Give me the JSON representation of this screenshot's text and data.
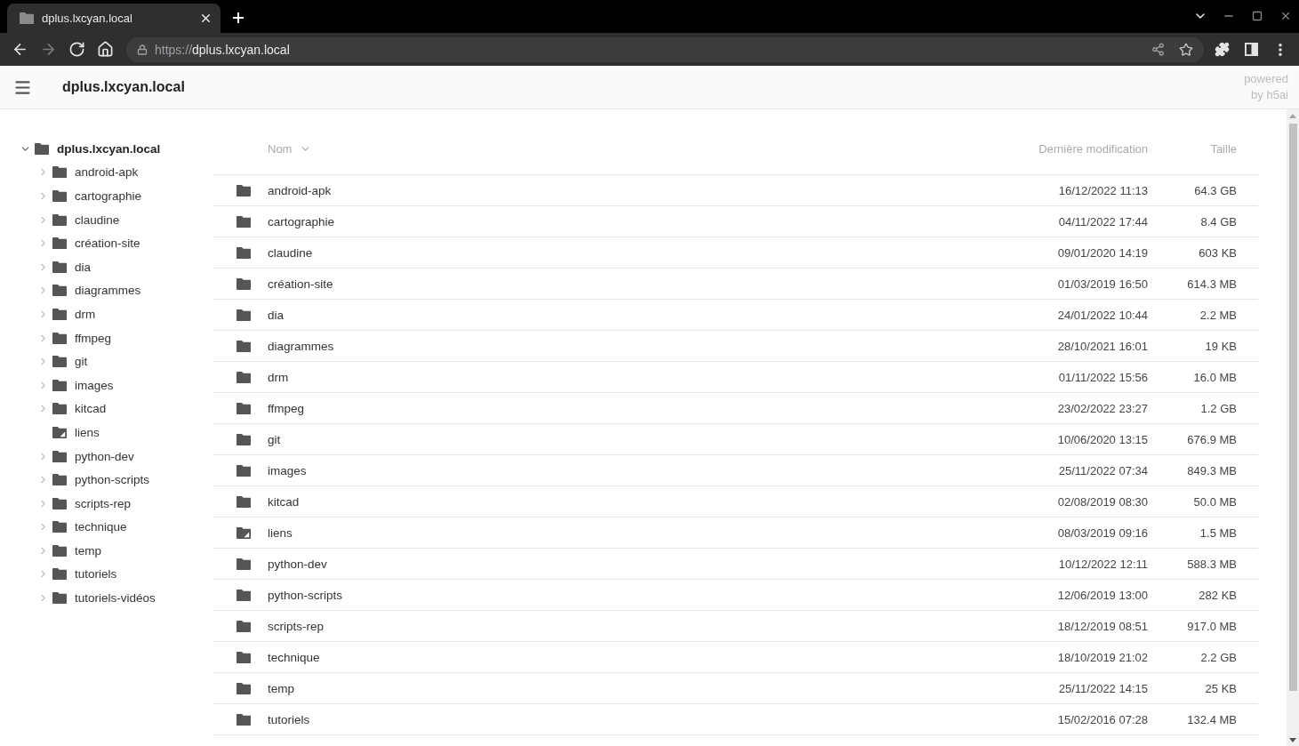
{
  "browser": {
    "tab": {
      "title": "dplus.lxcyan.local"
    },
    "nav_buttons": [
      {
        "kind": "back",
        "disabled": false
      },
      {
        "kind": "forward",
        "disabled": true
      },
      {
        "kind": "reload",
        "disabled": false
      },
      {
        "kind": "home",
        "disabled": false
      }
    ],
    "address": {
      "scheme": "https://",
      "host": "dplus.lxcyan.local"
    }
  },
  "header": {
    "title": "dplus.lxcyan.local",
    "credit": "powered by h5ai"
  },
  "tree": {
    "label": "dplus.lxcyan.local",
    "kind": "folder",
    "expanded": true,
    "children": [
      {
        "label": "android-apk",
        "kind": "folder",
        "expanded": false
      },
      {
        "label": "cartographie",
        "kind": "folder",
        "expanded": false
      },
      {
        "label": "claudine",
        "kind": "folder",
        "expanded": false
      },
      {
        "label": "création-site",
        "kind": "folder",
        "expanded": false
      },
      {
        "label": "dia",
        "kind": "folder",
        "expanded": false
      },
      {
        "label": "diagrammes",
        "kind": "folder",
        "expanded": false
      },
      {
        "label": "drm",
        "kind": "folder",
        "expanded": false
      },
      {
        "label": "ffmpeg",
        "kind": "folder",
        "expanded": false
      },
      {
        "label": "git",
        "kind": "folder",
        "expanded": false
      },
      {
        "label": "images",
        "kind": "folder",
        "expanded": false
      },
      {
        "label": "kitcad",
        "kind": "folder",
        "expanded": false
      },
      {
        "label": "liens",
        "kind": "link"
      },
      {
        "label": "python-dev",
        "kind": "folder",
        "expanded": false
      },
      {
        "label": "python-scripts",
        "kind": "folder",
        "expanded": false
      },
      {
        "label": "scripts-rep",
        "kind": "folder",
        "expanded": false
      },
      {
        "label": "technique",
        "kind": "folder",
        "expanded": false
      },
      {
        "label": "temp",
        "kind": "folder",
        "expanded": false
      },
      {
        "label": "tutoriels",
        "kind": "folder",
        "expanded": false
      },
      {
        "label": "tutoriels-vidéos",
        "kind": "folder",
        "expanded": false
      }
    ]
  },
  "table": {
    "columns": [
      {
        "label": "Nom",
        "sorted": true
      },
      {
        "label": "Dernière modification",
        "sorted": false
      },
      {
        "label": "Taille",
        "sorted": false
      }
    ],
    "rows": [
      {
        "kind": "folder",
        "name": "android-apk",
        "modified": "16/12/2022 11:13",
        "size": "64.3 GB"
      },
      {
        "kind": "folder",
        "name": "cartographie",
        "modified": "04/11/2022 17:44",
        "size": "8.4 GB"
      },
      {
        "kind": "folder",
        "name": "claudine",
        "modified": "09/01/2020 14:19",
        "size": "603 KB"
      },
      {
        "kind": "folder",
        "name": "création-site",
        "modified": "01/03/2019 16:50",
        "size": "614.3 MB"
      },
      {
        "kind": "folder",
        "name": "dia",
        "modified": "24/01/2022 10:44",
        "size": "2.2 MB"
      },
      {
        "kind": "folder",
        "name": "diagrammes",
        "modified": "28/10/2021 16:01",
        "size": "19 KB"
      },
      {
        "kind": "folder",
        "name": "drm",
        "modified": "01/11/2022 15:56",
        "size": "16.0 MB"
      },
      {
        "kind": "folder",
        "name": "ffmpeg",
        "modified": "23/02/2022 23:27",
        "size": "1.2 GB"
      },
      {
        "kind": "folder",
        "name": "git",
        "modified": "10/06/2020 13:15",
        "size": "676.9 MB"
      },
      {
        "kind": "folder",
        "name": "images",
        "modified": "25/11/2022 07:34",
        "size": "849.3 MB"
      },
      {
        "kind": "folder",
        "name": "kitcad",
        "modified": "02/08/2019 08:30",
        "size": "50.0 MB"
      },
      {
        "kind": "link",
        "name": "liens",
        "modified": "08/03/2019 09:16",
        "size": "1.5 MB"
      },
      {
        "kind": "folder",
        "name": "python-dev",
        "modified": "10/12/2022 12:11",
        "size": "588.3 MB"
      },
      {
        "kind": "folder",
        "name": "python-scripts",
        "modified": "12/06/2019 13:00",
        "size": "282 KB"
      },
      {
        "kind": "folder",
        "name": "scripts-rep",
        "modified": "18/12/2019 08:51",
        "size": "917.0 MB"
      },
      {
        "kind": "folder",
        "name": "technique",
        "modified": "18/10/2019 21:02",
        "size": "2.2 GB"
      },
      {
        "kind": "folder",
        "name": "temp",
        "modified": "25/11/2022 14:15",
        "size": "25 KB"
      },
      {
        "kind": "folder",
        "name": "tutoriels",
        "modified": "15/02/2016 07:28",
        "size": "132.4 MB"
      }
    ]
  }
}
